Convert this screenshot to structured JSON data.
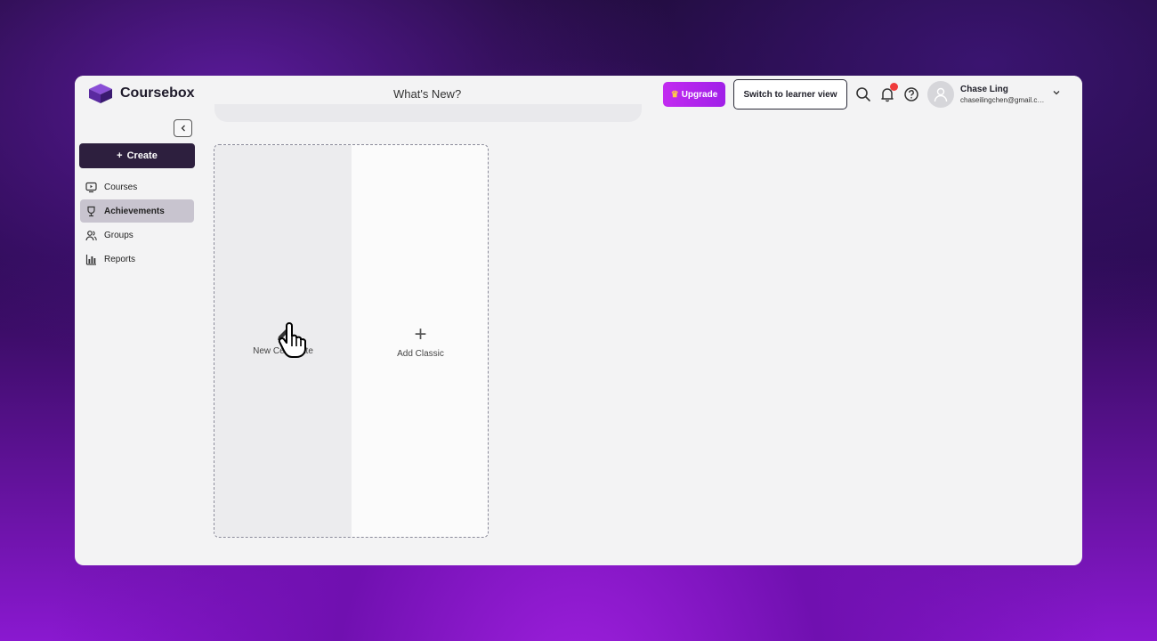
{
  "app": {
    "name": "Coursebox",
    "whats_new": "What's New?"
  },
  "header": {
    "upgrade_label": "Upgrade",
    "learner_view_label": "Switch to learner view",
    "user_name": "Chase Ling",
    "user_email": "chaseilingchen@gmail.com",
    "icons": [
      "search-icon",
      "bell-icon",
      "help-icon",
      "avatar",
      "chevron-down-icon"
    ],
    "notification_color": "#ef3b3b"
  },
  "sidebar": {
    "create_label": "Create",
    "items": [
      {
        "label": "Courses",
        "icon": "monitor-icon",
        "active": false
      },
      {
        "label": "Achievements",
        "icon": "trophy-icon",
        "active": true
      },
      {
        "label": "Groups",
        "icon": "users-icon",
        "active": false
      },
      {
        "label": "Reports",
        "icon": "bar-chart-icon",
        "active": false
      }
    ]
  },
  "main": {
    "new_certificate_label": "New Certificate",
    "add_classic_label": "Add Classic"
  },
  "colors": {
    "accent": "#a020e8",
    "create_bg": "#2d1f3e",
    "active_nav": "#c8c4cf"
  }
}
